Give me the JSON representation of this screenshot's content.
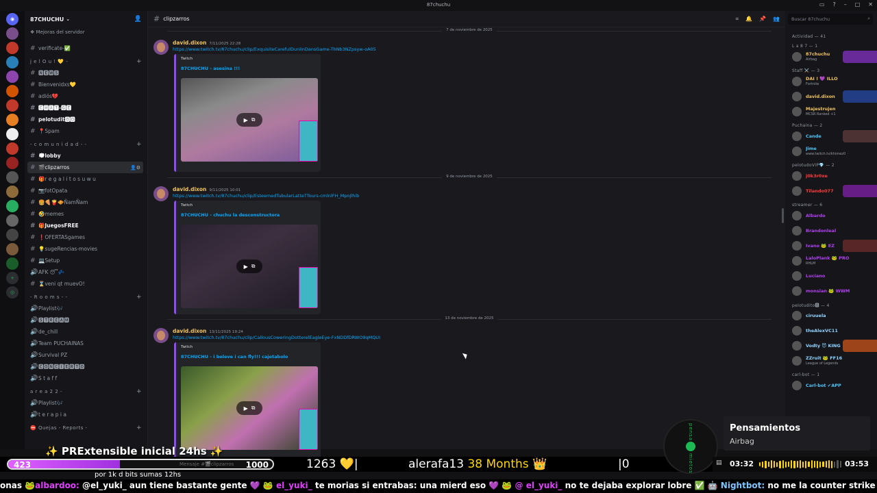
{
  "window": {
    "title": "87chuchu"
  },
  "server": {
    "name": "87CHUCHU",
    "boost_label": "Mejoras del servidor"
  },
  "channels": [
    {
      "type": "ch",
      "icon": "#",
      "label": "verificate-✅"
    },
    {
      "type": "cat",
      "label": "j e l O u ! 💛 -"
    },
    {
      "type": "ch",
      "icon": "#",
      "label": "🅽🅴🆆🆂"
    },
    {
      "type": "ch",
      "icon": "#",
      "label": "Bienvenidxs💛"
    },
    {
      "type": "ch",
      "icon": "#",
      "label": "adiós💔"
    },
    {
      "type": "ch",
      "icon": "#",
      "label": "🅲🅷🅰🆃-🅶🅴",
      "unread": true
    },
    {
      "type": "ch",
      "icon": "#",
      "label": "pelotudit🅾🅾",
      "unread": true
    },
    {
      "type": "ch",
      "icon": "#",
      "label": "📍Spam"
    },
    {
      "type": "cat",
      "label": "- c o m u n i d a d - -"
    },
    {
      "type": "ch",
      "icon": "#",
      "label": "💭lobby",
      "unread": true
    },
    {
      "type": "ch",
      "icon": "#",
      "label": "🎬clipzarros",
      "selected": true
    },
    {
      "type": "ch",
      "icon": "#",
      "label": "🎁r e g a l i t o s u w u"
    },
    {
      "type": "ch",
      "icon": "#",
      "label": "📷fotOpata"
    },
    {
      "type": "ch",
      "icon": "#",
      "label": "🍔🍕🍟🧇ÑamÑam"
    },
    {
      "type": "ch",
      "icon": "#",
      "label": "🤣memes"
    },
    {
      "type": "ch",
      "icon": "#",
      "label": "🎁JuegosFREE",
      "unread": true
    },
    {
      "type": "ch",
      "icon": "#",
      "label": "❗OFERTASgames"
    },
    {
      "type": "ch",
      "icon": "#",
      "label": "💡sugeRencias-movies"
    },
    {
      "type": "ch",
      "icon": "#",
      "label": "💻Setup"
    },
    {
      "type": "ch",
      "icon": "🔊",
      "label": "AFK 😴💤"
    },
    {
      "type": "ch",
      "icon": "#",
      "label": "⌛veni qt muevO!"
    },
    {
      "type": "cat",
      "label": "- R o o m s - -"
    },
    {
      "type": "ch",
      "icon": "🔊",
      "label": "Playlist🎶"
    },
    {
      "type": "ch",
      "icon": "🔊",
      "label": "🆂🆃🆁🅴🅰🅼"
    },
    {
      "type": "ch",
      "icon": "🔊",
      "label": "de_chill"
    },
    {
      "type": "ch",
      "icon": "🔊",
      "label": "Team PUCHAINAS"
    },
    {
      "type": "ch",
      "icon": "🔊",
      "label": "Survival PZ"
    },
    {
      "type": "ch",
      "icon": "🔊",
      "label": "🅲🅾🅽🅲🅸🅴🆁🆃🅾"
    },
    {
      "type": "ch",
      "icon": "🔊",
      "label": "S t a f f"
    },
    {
      "type": "cat",
      "label": "a r e a 2 2 -"
    },
    {
      "type": "ch",
      "icon": "🔊",
      "label": "Playlist🎶"
    },
    {
      "type": "ch",
      "icon": "🔊",
      "label": "t e r a p i a"
    },
    {
      "type": "cat",
      "label": "⛔ Quejas - Reports -"
    }
  ],
  "chat": {
    "channel": "clipzarros",
    "messages": [
      {
        "date": "7 de noviembre de 2025",
        "author": "david.dixon",
        "time": "7/11/2025 22:28",
        "link": "https://www.twitch.tv/87chuchu/clip/ExquisiteCarefulDunlinDansGame-ThNb3NZpsyw-oA05",
        "provider": "Twitch",
        "title": "87CHUCHU - asesina !!!"
      },
      {
        "date": "9 de noviembre de 2025",
        "author": "david.dixon",
        "time": "9/11/2025 10:01",
        "link": "https://www.twitch.tv/87chuchu/clip/EsteemedTubularLatteTTours-cmlnlFH_MpnJlhib",
        "provider": "Twitch",
        "title": "87CHUCHU - chuchu la desconstructora"
      },
      {
        "date": "13 de noviembre de 2025",
        "author": "david.dixon",
        "time": "13/11/2025 19:24",
        "link": "https://www.twitch.tv/87chuchu/clip/CallousCoweringDotterelEagleEye-FxNDDfDRWO9qMQUI",
        "provider": "Twitch",
        "title": "87CHUCHU - i beleve i can fly!!! cajetabolo"
      }
    ]
  },
  "members": {
    "search_placeholder": "Buscar 87chuchu",
    "activity_label": "Actividad — 41",
    "groups": [
      {
        "label": "L a 8 7 — 1",
        "items": [
          {
            "name": "87chuchu",
            "sub": "Airbag",
            "color": "#f0c35b",
            "bar": "#7c2fb8"
          }
        ]
      },
      {
        "label": "Staff ⚔️ — 3",
        "items": [
          {
            "name": "DAI ! 💜 ILLO",
            "sub": "Fortnite",
            "color": "#f0c35b"
          },
          {
            "name": "david.dixon",
            "sub": "",
            "color": "#f0c35b",
            "bar": "#2747a0"
          },
          {
            "name": "Majestrujen",
            "sub": "MCSR Ranked +1",
            "color": "#f0c35b"
          }
        ]
      },
      {
        "label": "Puchaina — 2",
        "items": [
          {
            "name": "Cande",
            "sub": "",
            "color": "#4fc3f7",
            "bar": "#5a3a3a"
          },
          {
            "name": "Jime",
            "sub": "www.twitch.tv/khimez0",
            "color": "#4fc3f7"
          }
        ]
      },
      {
        "label": "pelotudoVIP💎 — 2",
        "items": [
          {
            "name": "j0k3r0xe",
            "sub": "",
            "color": "#ff3b3b"
          },
          {
            "name": "Tilando077",
            "sub": "",
            "color": "#ff3b3b",
            "bar": "#7a1fa0"
          }
        ]
      },
      {
        "label": "streamer — 6",
        "items": [
          {
            "name": "Albardo",
            "sub": "",
            "color": "#b040f0"
          },
          {
            "name": "Brandonleal",
            "sub": "",
            "color": "#b040f0"
          },
          {
            "name": "Ivano 🐸 EZ",
            "sub": "",
            "color": "#b040f0",
            "bar": "#6a2a2a"
          },
          {
            "name": "LaloPlank 🐸 PRO",
            "sub": "RHLM",
            "color": "#b040f0"
          },
          {
            "name": "Luciano",
            "sub": "",
            "color": "#b040f0"
          },
          {
            "name": "monsian 🐸 WWM",
            "sub": "",
            "color": "#b040f0"
          }
        ]
      },
      {
        "label": "pelotudito🅾 — 4",
        "items": [
          {
            "name": "ciruuela",
            "sub": "",
            "color": "#8fd3ff"
          },
          {
            "name": "theAlexVC11",
            "sub": "",
            "color": "#8fd3ff"
          },
          {
            "name": "Vodty 😈 KING",
            "sub": "",
            "color": "#8fd3ff",
            "bar": "#c0501a"
          },
          {
            "name": "ZZruit 🐸 FF16",
            "sub": "League of Legends",
            "color": "#8fd3ff"
          }
        ]
      },
      {
        "label": "carl-bot — 1",
        "items": [
          {
            "name": "Carl-bot ✔APP",
            "sub": "",
            "color": "#4fc3f7"
          }
        ]
      }
    ]
  },
  "overlay": {
    "banner": "✨ PRExtensible inicial 24hs ✨",
    "bits_current": "423",
    "bits_goal": "1000",
    "bits_progress": 0.423,
    "message_placeholder": "Mensaje #🎬clipzarros",
    "count": "1263",
    "heart": "💛",
    "sub_name": "alerafa13",
    "sub_months": "38 Months",
    "crown": "👑",
    "zero": "0",
    "note": "por 1k d bits sumas 12hs"
  },
  "ticker": [
    {
      "t": "onas 🐸",
      "c": "n"
    },
    {
      "t": "albardoo:",
      "c": "m"
    },
    {
      "t": " @el_yuki_ aun tiene bastante gente ",
      "c": "n"
    },
    {
      "t": "💜 🐸 el_yuki_ ",
      "c": "m"
    },
    {
      "t": " te morias si entrabas: una mierd eso ",
      "c": "n"
    },
    {
      "t": "💜 🐸 @ el_yuki_ ",
      "c": "m"
    },
    {
      "t": " no te dejaba explorar lobre ",
      "c": "n"
    },
    {
      "t": "✅ 🤖 Nightbot:",
      "c": "b"
    },
    {
      "t": " no me la counter strike ",
      "c": "n"
    }
  ],
  "nowplaying": {
    "title": "Pensamientos",
    "artist": "Airbag",
    "elapsed": "03:32",
    "total": "03:53",
    "progress": 0.91,
    "vinyl_top": "pensa",
    "vinyl_bottom": "mietos"
  }
}
